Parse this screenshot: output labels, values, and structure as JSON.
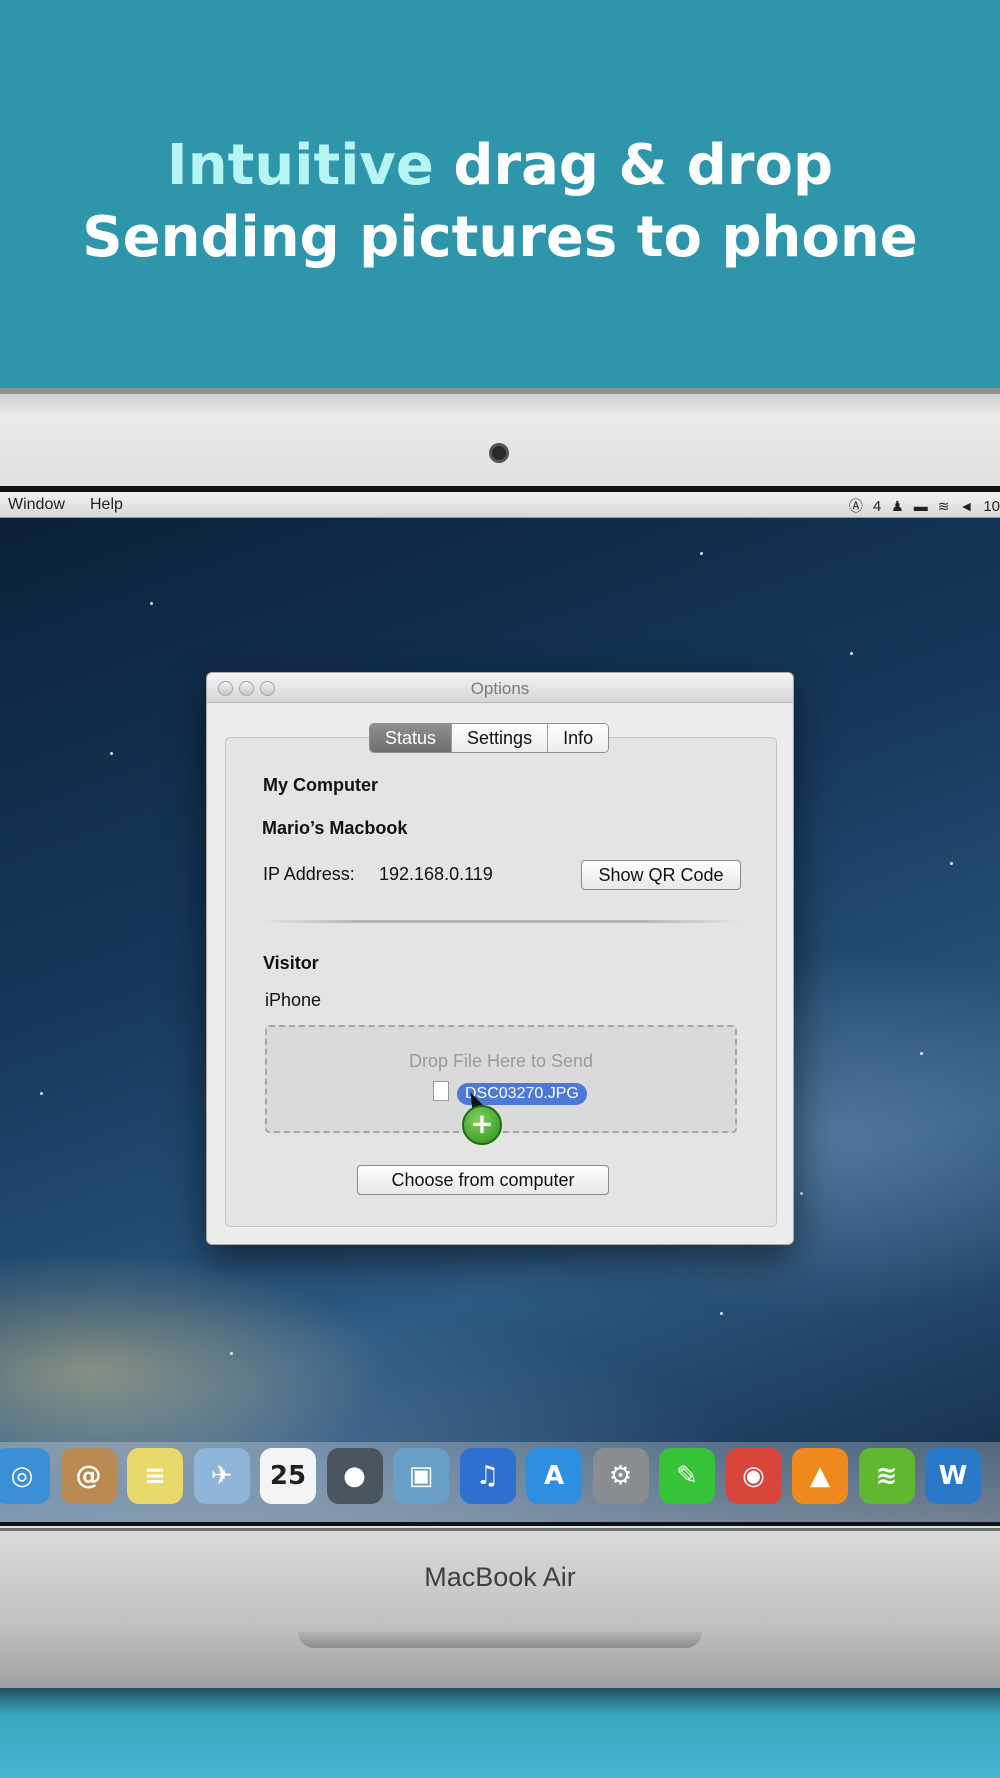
{
  "banner": {
    "line1_accent": "Intuitive",
    "line1_rest": " drag & drop",
    "line2": "Sending pictures to phone"
  },
  "menubar": {
    "items": [
      "Window",
      "Help"
    ],
    "status_text": "4",
    "clock": "10"
  },
  "window": {
    "title": "Options",
    "tabs": [
      {
        "label": "Status",
        "active": true
      },
      {
        "label": "Settings",
        "active": false
      },
      {
        "label": "Info",
        "active": false
      }
    ],
    "my_computer_heading": "My Computer",
    "computer_name": "Mario’s Macbook",
    "ip_label": "IP Address:",
    "ip_value": "192.168.0.119",
    "show_qr_label": "Show QR Code",
    "visitor_heading": "Visitor",
    "visitor_name": "iPhone",
    "drop_text": "Drop File Here to Send",
    "dragged_file": "DSC03270.JPG",
    "choose_label": "Choose from computer"
  },
  "dock": {
    "icons": [
      {
        "name": "safari-icon",
        "glyph": "◎",
        "color": "#3b8fd6"
      },
      {
        "name": "contacts-icon",
        "glyph": "@",
        "color": "#b98a52"
      },
      {
        "name": "notes-icon",
        "glyph": "≡",
        "color": "#e9d86a"
      },
      {
        "name": "maps-icon",
        "glyph": "✈",
        "color": "#8fb6d8"
      },
      {
        "name": "calendar-icon",
        "glyph": "25",
        "color": "#f4f4f4"
      },
      {
        "name": "facetime-icon",
        "glyph": "●",
        "color": "#4a5560"
      },
      {
        "name": "iphoto-icon",
        "glyph": "▣",
        "color": "#6aa0c8"
      },
      {
        "name": "itunes-icon",
        "glyph": "♫",
        "color": "#2f6fcf"
      },
      {
        "name": "app-store-icon",
        "glyph": "A",
        "color": "#2f8ee0"
      },
      {
        "name": "system-preferences-icon",
        "glyph": "⚙",
        "color": "#8a8d90"
      },
      {
        "name": "transfer-app-icon",
        "glyph": "✎",
        "color": "#35c33a"
      },
      {
        "name": "chrome-icon",
        "glyph": "◉",
        "color": "#d8453a"
      },
      {
        "name": "vlc-icon",
        "glyph": "▲",
        "color": "#f08a1c"
      },
      {
        "name": "spotify-icon",
        "glyph": "≋",
        "color": "#5fb82f"
      },
      {
        "name": "word-icon",
        "glyph": "W",
        "color": "#2a78c8"
      }
    ]
  },
  "laptop": {
    "brand": "MacBook Air"
  }
}
